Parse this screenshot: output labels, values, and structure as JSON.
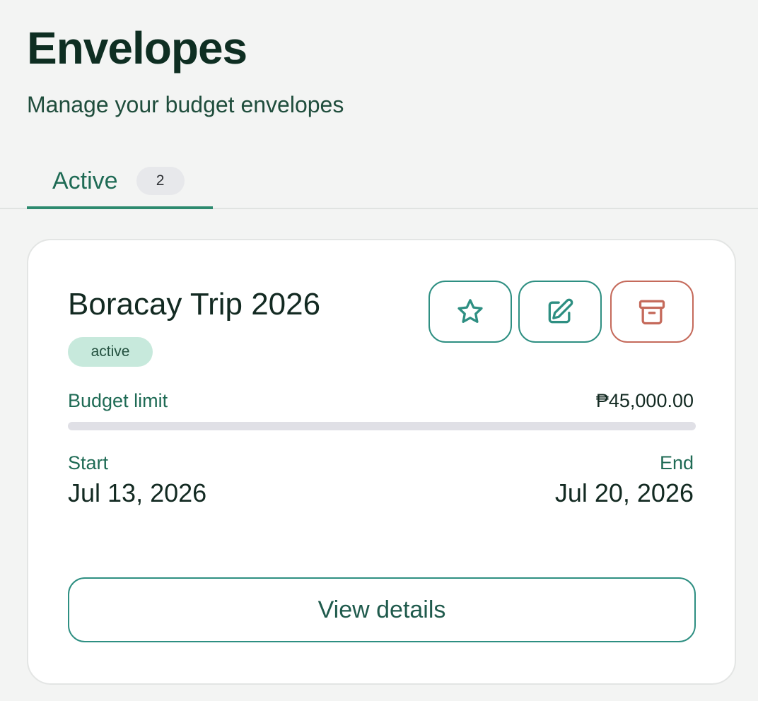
{
  "header": {
    "title": "Envelopes",
    "subtitle": "Manage your budget envelopes"
  },
  "tabs": [
    {
      "label": "Active",
      "count": "2",
      "selected": true
    }
  ],
  "envelopes": [
    {
      "name": "Boracay Trip 2026",
      "status": "active",
      "budget_label": "Budget limit",
      "budget_value": "₱45,000.00",
      "progress_fraction": 0,
      "start_label": "Start",
      "start_date": "Jul 13, 2026",
      "end_label": "End",
      "end_date": "Jul 20, 2026",
      "actions": {
        "favorite_icon": "star-icon",
        "edit_icon": "edit-icon",
        "archive_icon": "archive-icon"
      },
      "view_label": "View details"
    }
  ],
  "colors": {
    "accent": "#2c8a6e",
    "action_border": "#2e8f82",
    "danger": "#c56a5b",
    "badge_bg": "#c7e9dc"
  }
}
